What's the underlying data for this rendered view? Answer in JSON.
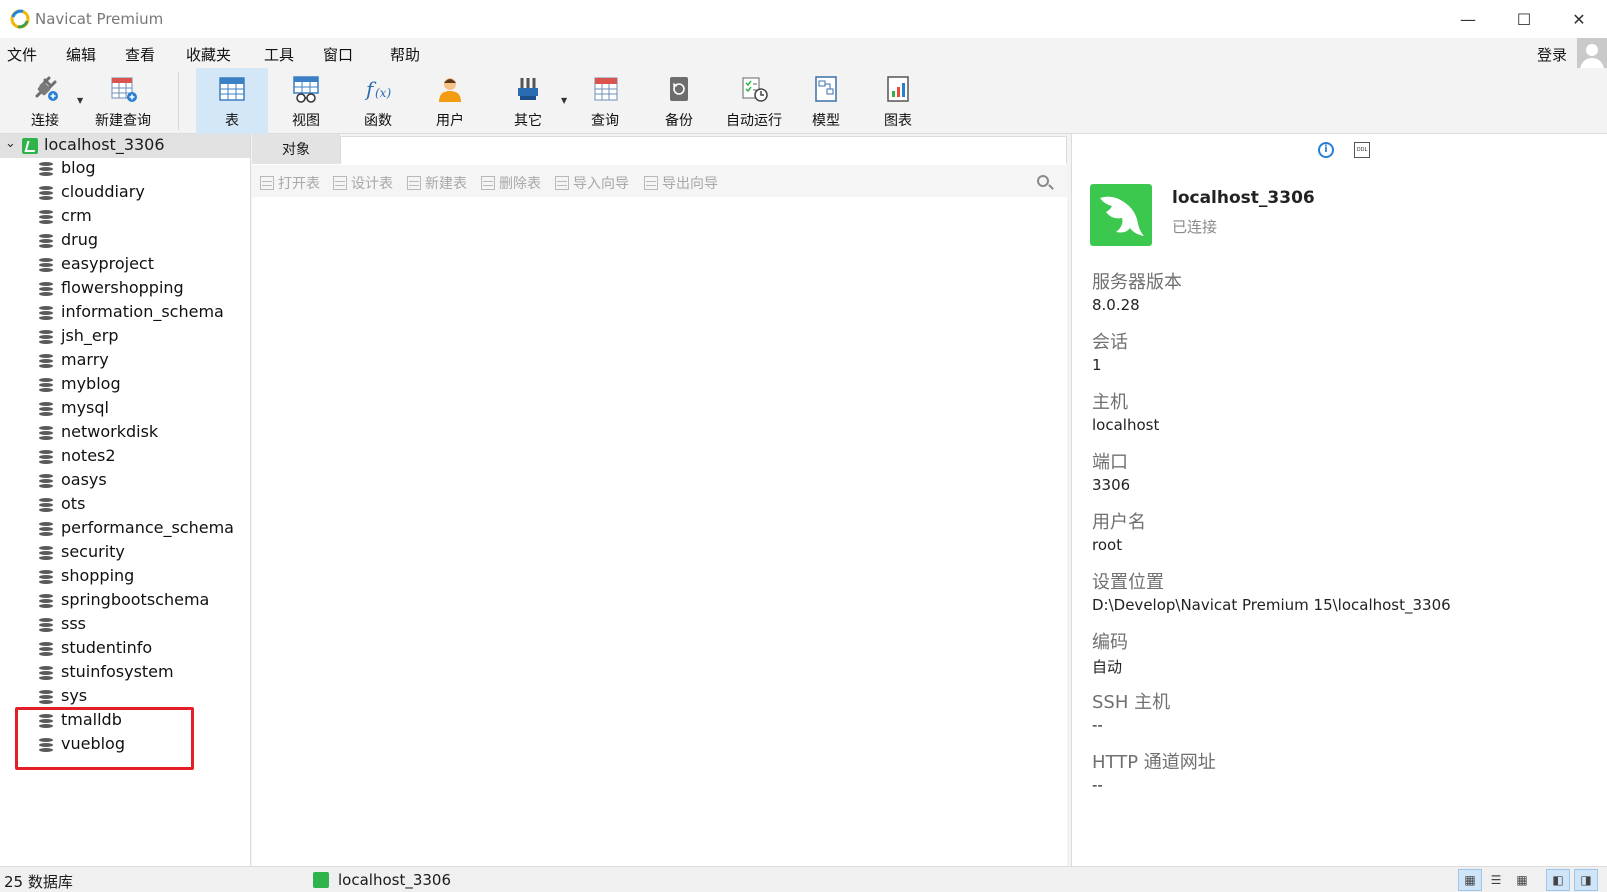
{
  "window": {
    "title": "Navicat Premium",
    "minimize_icon": "minimize-icon",
    "maximize_icon": "maximize-icon",
    "close_icon": "close-icon"
  },
  "menu": {
    "items": [
      "文件",
      "编辑",
      "查看",
      "收藏夹",
      "工具",
      "窗口",
      "帮助"
    ],
    "login": "登录"
  },
  "toolbar": {
    "items": [
      {
        "label": "连接",
        "icon": "plug-icon"
      },
      {
        "label": "新建查询",
        "icon": "new-query-icon"
      },
      {
        "label": "表",
        "icon": "table-icon",
        "active": true
      },
      {
        "label": "视图",
        "icon": "view-icon"
      },
      {
        "label": "函数",
        "icon": "function-icon"
      },
      {
        "label": "用户",
        "icon": "user-icon"
      },
      {
        "label": "其它",
        "icon": "tools-icon"
      },
      {
        "label": "查询",
        "icon": "query-icon"
      },
      {
        "label": "备份",
        "icon": "backup-icon"
      },
      {
        "label": "自动运行",
        "icon": "automation-icon"
      },
      {
        "label": "模型",
        "icon": "model-icon"
      },
      {
        "label": "图表",
        "icon": "chart-icon"
      }
    ]
  },
  "tree": {
    "connection": "localhost_3306",
    "databases": [
      "blog",
      "clouddiary",
      "crm",
      "drug",
      "easyproject",
      "flowershopping",
      "information_schema",
      "jsh_erp",
      "marry",
      "myblog",
      "mysql",
      "networkdisk",
      "notes2",
      "oasys",
      "ots",
      "performance_schema",
      "security",
      "shopping",
      "springbootschema",
      "sss",
      "studentinfo",
      "stuinfosystem",
      "sys",
      "tmalldb",
      "vueblog"
    ]
  },
  "objects": {
    "tab_label": "对象",
    "actions": [
      "打开表",
      "设计表",
      "新建表",
      "删除表",
      "导入向导",
      "导出向导"
    ]
  },
  "info": {
    "name": "localhost_3306",
    "status": "已连接",
    "fields": [
      {
        "label": "服务器版本",
        "value": "8.0.28"
      },
      {
        "label": "会话",
        "value": "1"
      },
      {
        "label": "主机",
        "value": "localhost"
      },
      {
        "label": "端口",
        "value": "3306"
      },
      {
        "label": "用户名",
        "value": "root"
      },
      {
        "label": "设置位置",
        "value": "D:\\Develop\\Navicat Premium 15\\localhost_3306"
      },
      {
        "label": "编码",
        "value": "自动"
      },
      {
        "label": "SSH 主机",
        "value": "--"
      },
      {
        "label": "HTTP 通道网址",
        "value": "--"
      }
    ]
  },
  "status": {
    "count": "25 数据库",
    "connection": "localhost_3306"
  },
  "colors": {
    "accent": "#d3e7f7",
    "connection_green": "#3cc84f",
    "highlight_red": "#e41e26"
  }
}
